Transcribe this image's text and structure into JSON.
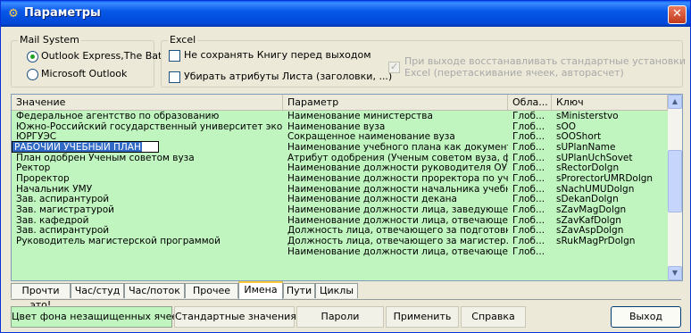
{
  "window": {
    "title": "Параметры",
    "close_glyph": "✕"
  },
  "mail_system": {
    "legend": "Mail System",
    "options": [
      {
        "label": "Outlook Express,The Bat",
        "selected": true
      },
      {
        "label": "Microsoft Outlook",
        "selected": false
      }
    ]
  },
  "excel": {
    "legend": "Excel",
    "options": [
      {
        "label": "Не сохранять Книгу перед выходом",
        "checked": false
      },
      {
        "label": "Убирать атрибуты Листа (заголовки, ...)",
        "checked": false
      }
    ],
    "disabled_option": {
      "line1": "При выходе восстанавливать стандартные установки",
      "line2": "Excel (перетаскивание ячеек, авторасчет)",
      "checked": true
    }
  },
  "table": {
    "columns": [
      "Значение",
      "Параметр",
      "Обла...",
      "Ключ"
    ],
    "rows": [
      [
        "Федеральное агентство по образованию",
        "Наименование министерства",
        "Глоб...",
        "sMinisterstvo"
      ],
      [
        "Южно-Российский государственный университет эконо...",
        "Наименование вуза",
        "Глоб...",
        "sOO"
      ],
      [
        "ЮРГУЭС",
        "Сокращенное наименование вуза",
        "Глоб...",
        "sOOShort"
      ],
      [
        "РАБОЧИЙ УЧЕБНЫЙ ПЛАН",
        "Наименование учебного плана как документа",
        "Глоб...",
        "sUPlanName"
      ],
      [
        "План одобрен Ученым советом вуза",
        "Атрибут одобрения (Ученым советом вуза, ф...",
        "Глоб...",
        "sUPlanUchSovet"
      ],
      [
        "Ректор",
        "Наименование должности руководителя ОУ",
        "Глоб...",
        "sRectorDolgn"
      ],
      [
        "Проректор",
        "Наименование должности проректора по уче...",
        "Глоб...",
        "sProrectorUMRDolgn"
      ],
      [
        "Начальник УМУ",
        "Наименование должности начальника учебн...",
        "Глоб...",
        "sNachUMUDolgn"
      ],
      [
        "Зав. аспирантурой",
        "Наименование должности декана",
        "Глоб...",
        "sDekanDolgn"
      ],
      [
        "Зав. магистратурой",
        "Наименование должности лица, заведующег...",
        "Глоб...",
        "sZavMagDolgn"
      ],
      [
        "Зав. кафедрой",
        "Наименование должности лица, отвечающег...",
        "Глоб...",
        "sZavKafDolgn"
      ],
      [
        "Зав. аспирантурой",
        "Должность лица, отвечающего за подготовк...",
        "Глоб...",
        "sZavAspDolgn"
      ],
      [
        "Руководитель магистерской программой",
        "Должность лица, отвечающего за магистер...",
        "Глоб...",
        "sRukMagPrDolgn"
      ],
      [
        "",
        "Наименование должности лица, отвечающего...",
        "Глоб...",
        ""
      ],
      [
        "",
        "",
        "",
        ""
      ],
      [
        "",
        "",
        "",
        ""
      ]
    ],
    "editing_row": 3,
    "row_color": "#c0f5c0"
  },
  "tabs": [
    {
      "label": "Прочти это!",
      "selected": false
    },
    {
      "label": "Час/студ",
      "selected": false
    },
    {
      "label": "Час/поток",
      "selected": false
    },
    {
      "label": "Прочее",
      "selected": false
    },
    {
      "label": "Имена",
      "selected": true
    },
    {
      "label": "Пути",
      "selected": false
    },
    {
      "label": "Циклы",
      "selected": false
    }
  ],
  "buttons": {
    "bg_color": "Цвет фона незащищенных ячеек",
    "defaults": "Стандартные значения",
    "passwords": "Пароли",
    "apply": "Применить",
    "help": "Справка",
    "exit": "Выход"
  },
  "colors": {
    "title_blue": "#0757e8",
    "unprotected_green": "#c0f5c0",
    "selection": "#316ac5",
    "tab_accent": "#ffc83c"
  }
}
